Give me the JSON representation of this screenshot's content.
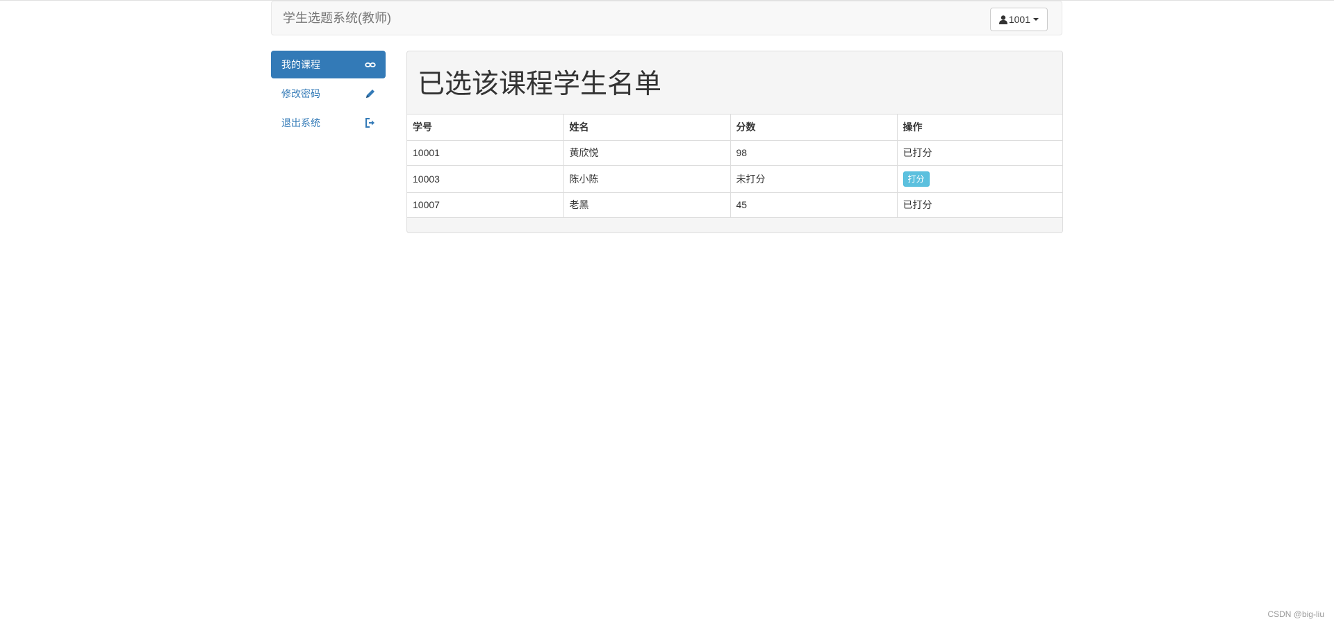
{
  "navbar": {
    "brand": "学生选题系统(教师)",
    "user_label": "1001"
  },
  "sidebar": {
    "items": [
      {
        "label": "我的课程",
        "icon": "eye-glasses-icon",
        "active": true
      },
      {
        "label": "修改密码",
        "icon": "pencil-icon",
        "active": false
      },
      {
        "label": "退出系统",
        "icon": "logout-icon",
        "active": false
      }
    ]
  },
  "panel": {
    "title": "已选该课程学生名单",
    "columns": [
      "学号",
      "姓名",
      "分数",
      "操作"
    ],
    "rows": [
      {
        "id": "10001",
        "name": "黄欣悦",
        "score": "98",
        "action": "已打分"
      },
      {
        "id": "10003",
        "name": "陈小陈",
        "score": "未打分",
        "action": "打分"
      },
      {
        "id": "10007",
        "name": "老黑",
        "score": "45",
        "action": "已打分"
      }
    ]
  },
  "watermark": "CSDN @big-liu",
  "colors": {
    "primary": "#337ab7",
    "info_button": "#5bc0de"
  }
}
